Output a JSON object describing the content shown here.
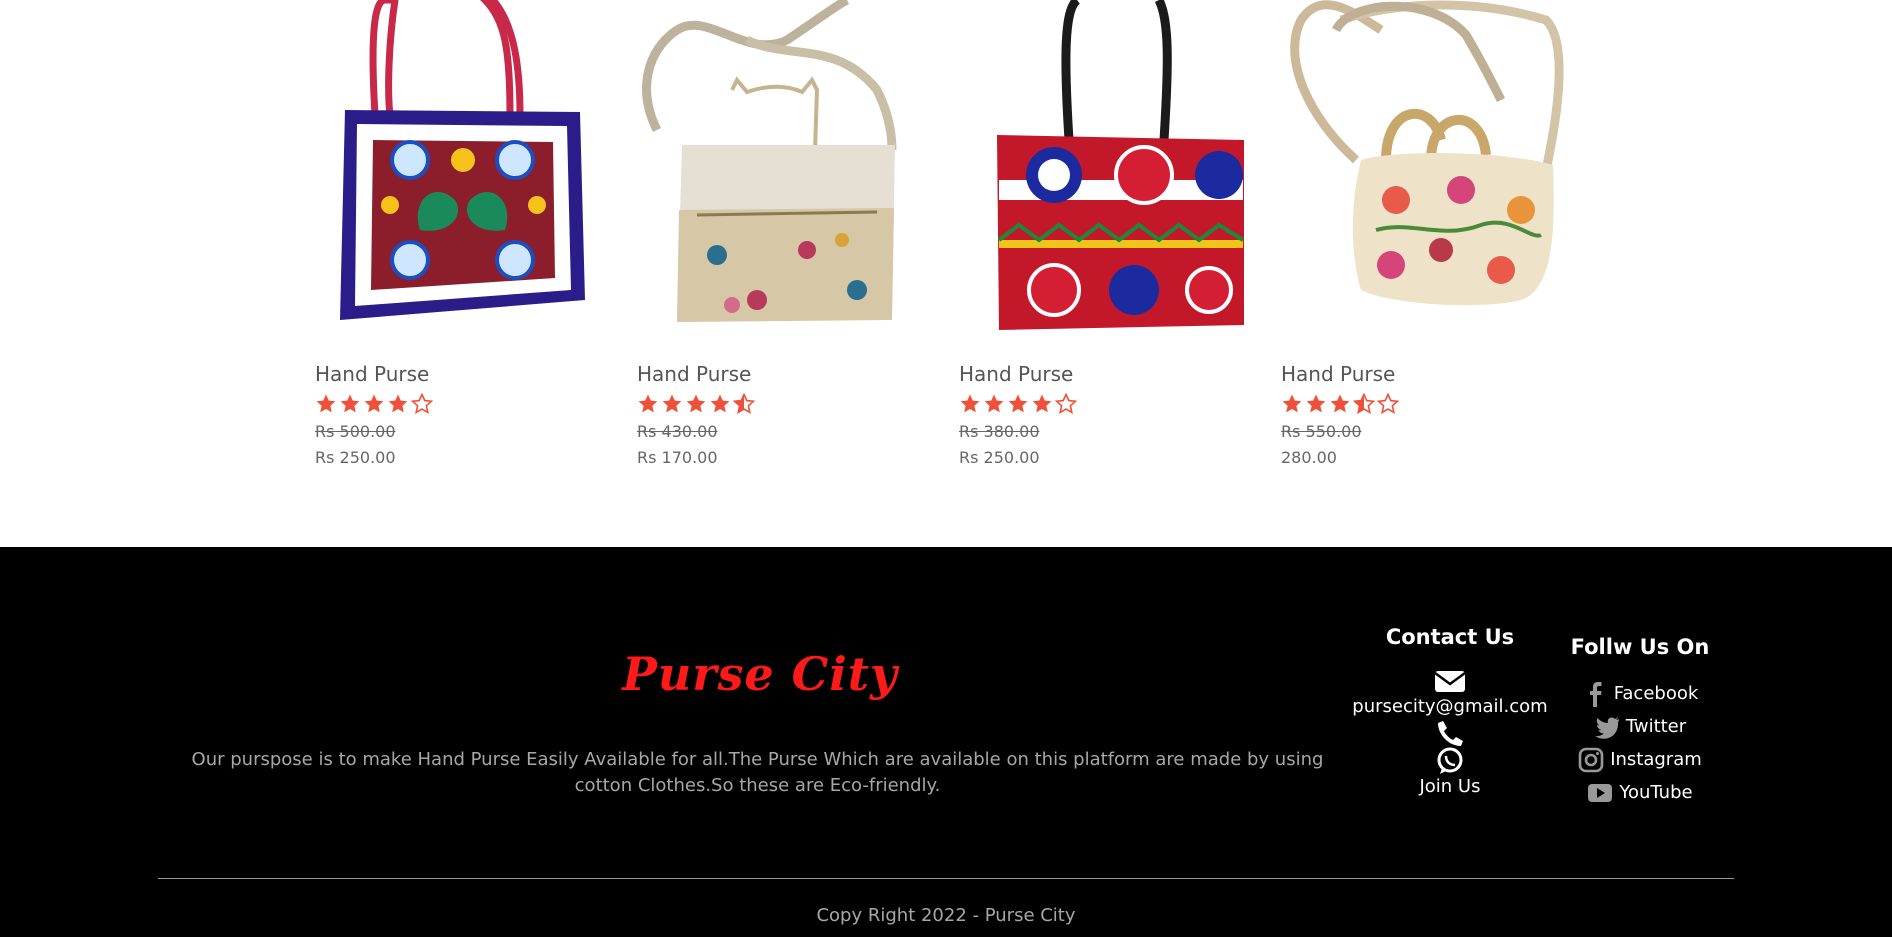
{
  "products": [
    {
      "name": "Hand Purse",
      "rating": 4,
      "old_price": "Rs 500.00",
      "new_price": "Rs 250.00",
      "image": "embroidered-peacock-purse"
    },
    {
      "name": "Hand Purse",
      "rating": 4.5,
      "old_price": "Rs 430.00",
      "new_price": "Rs 170.00",
      "image": "cream-floral-purse"
    },
    {
      "name": "Hand Purse",
      "rating": 4,
      "old_price": "Rs 380.00",
      "new_price": "Rs 250.00",
      "image": "red-floral-tote"
    },
    {
      "name": "Hand Purse",
      "rating": 3.5,
      "old_price": "Rs 550.00",
      "new_price": "280.00",
      "image": "cream-ring-handle-purse"
    }
  ],
  "footer": {
    "logo": "Purse City",
    "about": "Our purspose is to make Hand Purse Easily Available for all.The Purse Which are available on this platform are made by using cotton Clothes.So these are Eco-friendly.",
    "contact": {
      "heading": "Contact Us",
      "email": "pursecity@gmail.com",
      "join": "Join Us"
    },
    "follow": {
      "heading": "Follw Us On",
      "links": [
        "Facebook",
        "Twitter",
        "Instagram",
        "YouTube"
      ]
    },
    "copyright": "Copy Right 2022 - Purse City"
  },
  "colors": {
    "star": "#f0503a",
    "logo": "#ff1a1a",
    "footer_bg": "#000000"
  }
}
